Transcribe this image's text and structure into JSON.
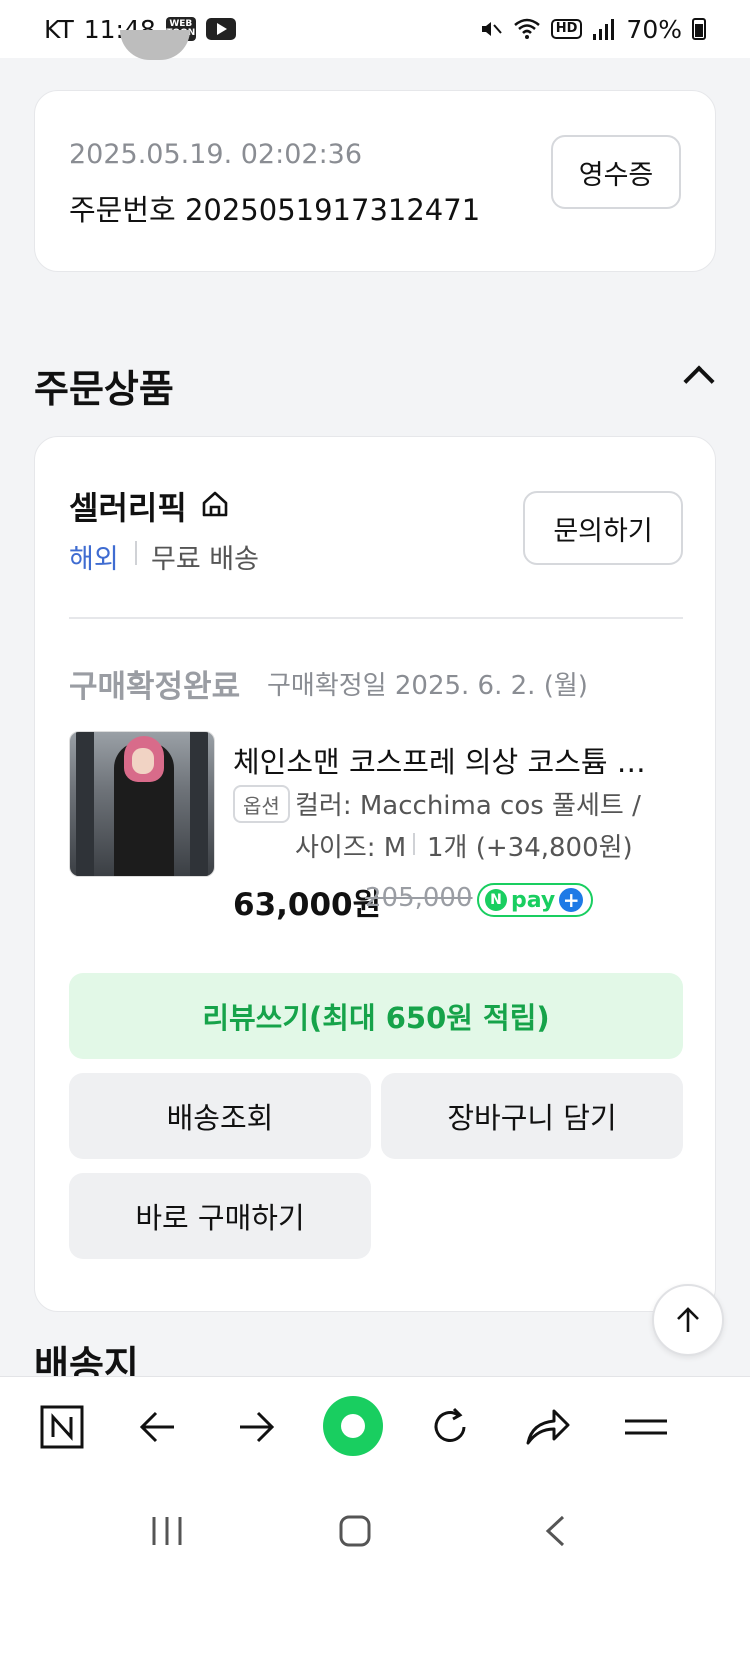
{
  "status_bar": {
    "carrier": "KT",
    "time": "11:48",
    "webtoon_badge": "WEB TOON",
    "hd_badge": "HD",
    "battery": "70%"
  },
  "order": {
    "datetime": "2025.05.19. 02:02:36",
    "number": "주문번호 2025051917312471",
    "receipt_button": "영수증"
  },
  "order_items": {
    "section_title": "주문상품",
    "store": {
      "name": "셀러리픽",
      "tag_overseas": "해외",
      "tag_shipping": "무료 배송",
      "inquiry_button": "문의하기"
    },
    "item": {
      "status": "구매확정완료",
      "confirm_date": "구매확정일 2025. 6. 2. (월)",
      "title": "체인소맨 코스프레 의상 코스튬 세트",
      "option_badge": "옵션",
      "option_line1": "컬러: Macchima cos 풀세트 /",
      "option_line2": "사이즈: M",
      "quantity": "1개 (+34,800원)",
      "price": "63,000원",
      "original_price": "205,000",
      "npay_label": "pay"
    },
    "buttons": {
      "review": "리뷰쓰기(최대 650원 적립)",
      "track": "배송조회",
      "cart": "장바구니 담기",
      "buy_now": "바로 구매하기"
    }
  },
  "shipping": {
    "section_title": "배송지"
  },
  "colors": {
    "accent_green": "#19ce60",
    "review_bg": "#e2f8e7",
    "overseas_blue": "#3f6cd1"
  }
}
